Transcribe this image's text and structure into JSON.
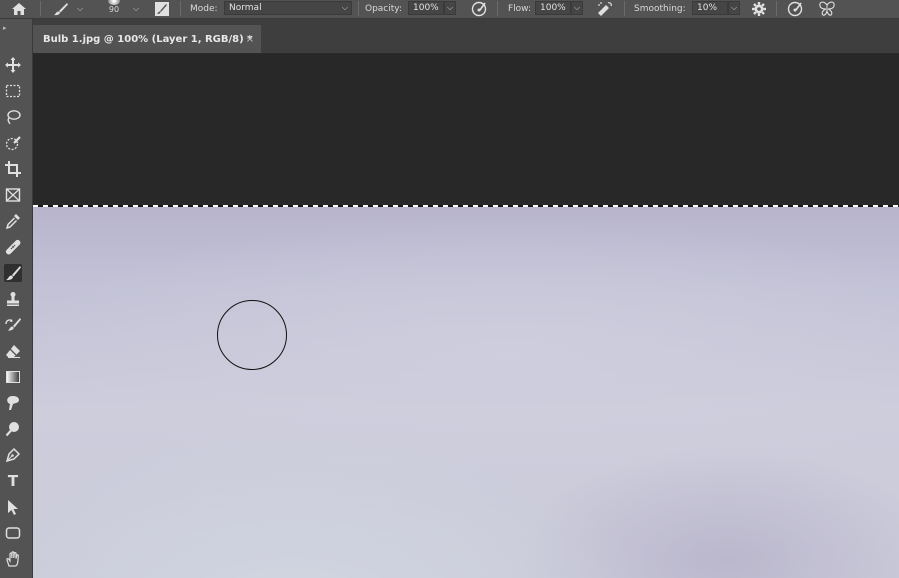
{
  "options_bar": {
    "brush_size": "90",
    "mode_label": "Mode:",
    "mode_value": "Normal",
    "opacity_label": "Opacity:",
    "opacity_value": "100%",
    "flow_label": "Flow:",
    "flow_value": "100%",
    "smoothing_label": "Smoothing:",
    "smoothing_value": "10%"
  },
  "document_tab": {
    "title": "Bulb 1.jpg @ 100% (Layer 1, RGB/8) *",
    "close_glyph": "×"
  },
  "toolbox": {
    "tools": [
      {
        "name": "move-tool",
        "icon": "move-icon"
      },
      {
        "name": "rectangular-marquee-tool",
        "icon": "marquee-icon"
      },
      {
        "name": "lasso-tool",
        "icon": "lasso-icon"
      },
      {
        "name": "quick-selection-tool",
        "icon": "quick-selection-icon"
      },
      {
        "name": "crop-tool",
        "icon": "crop-icon"
      },
      {
        "name": "frame-tool",
        "icon": "frame-icon"
      },
      {
        "name": "eyedropper-tool",
        "icon": "eyedropper-icon"
      },
      {
        "name": "healing-brush-tool",
        "icon": "bandage-icon"
      },
      {
        "name": "brush-tool",
        "icon": "brush-icon",
        "active": true
      },
      {
        "name": "clone-stamp-tool",
        "icon": "stamp-icon"
      },
      {
        "name": "history-brush-tool",
        "icon": "history-brush-icon"
      },
      {
        "name": "eraser-tool",
        "icon": "eraser-icon"
      },
      {
        "name": "gradient-tool",
        "icon": "gradient-icon"
      },
      {
        "name": "smudge-tool",
        "icon": "smudge-icon"
      },
      {
        "name": "dodge-tool",
        "icon": "dodge-icon"
      },
      {
        "name": "pen-tool",
        "icon": "pen-icon"
      },
      {
        "name": "type-tool",
        "icon": "type-icon",
        "glyph": "T"
      },
      {
        "name": "path-selection-tool",
        "icon": "arrow-icon"
      },
      {
        "name": "rectangle-tool",
        "icon": "rectangle-icon"
      },
      {
        "name": "hand-tool",
        "icon": "hand-icon"
      }
    ]
  },
  "colors": {
    "panel": "#535353",
    "workspace": "#282828",
    "canvas": "#c8c8d8"
  }
}
